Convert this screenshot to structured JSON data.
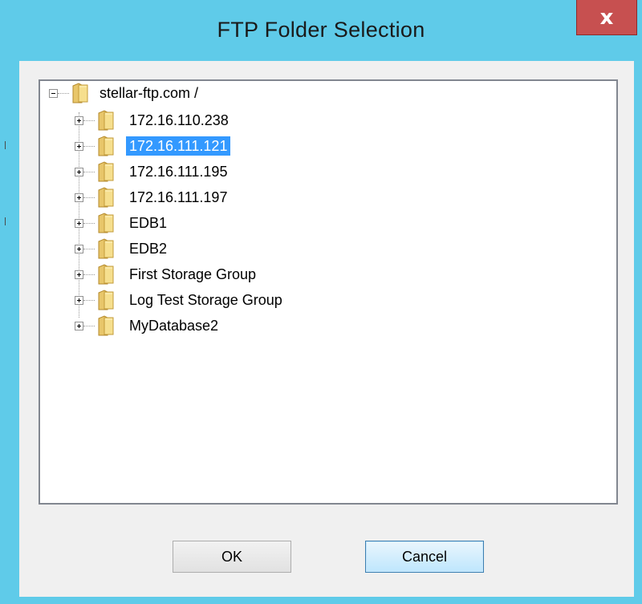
{
  "window": {
    "title": "FTP Folder Selection",
    "close_label": "x"
  },
  "tree": {
    "root": {
      "label": "stellar-ftp.com /",
      "expanded": true
    },
    "items": [
      {
        "label": "172.16.110.238",
        "selected": false
      },
      {
        "label": "172.16.111.121",
        "selected": true
      },
      {
        "label": "172.16.111.195",
        "selected": false
      },
      {
        "label": "172.16.111.197",
        "selected": false
      },
      {
        "label": "EDB1",
        "selected": false
      },
      {
        "label": "EDB2",
        "selected": false
      },
      {
        "label": "First Storage Group",
        "selected": false
      },
      {
        "label": "Log Test Storage Group",
        "selected": false
      },
      {
        "label": "MyDatabase2",
        "selected": false
      }
    ]
  },
  "buttons": {
    "ok_label": "OK",
    "cancel_label": "Cancel"
  },
  "colors": {
    "titlebar": "#5fcbe9",
    "close": "#c75050",
    "selection": "#3399ff"
  },
  "icons": {
    "folder": "folder-icon",
    "expander_plus": "expand-plus-icon",
    "expander_minus": "collapse-minus-icon",
    "close": "close-icon"
  }
}
